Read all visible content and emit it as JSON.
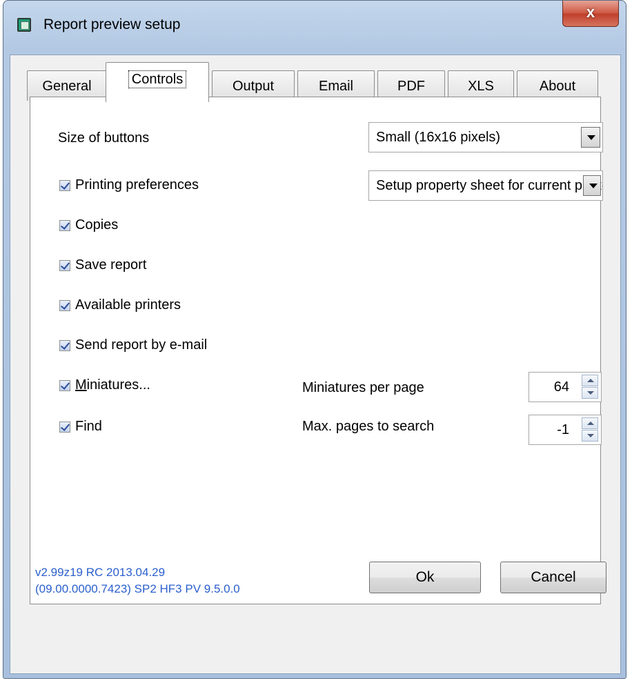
{
  "window": {
    "title": "Report preview setup",
    "close_glyph": "x"
  },
  "tabs": [
    {
      "label": "General",
      "active": false
    },
    {
      "label": "Controls",
      "active": true
    },
    {
      "label": "Output",
      "active": false
    },
    {
      "label": "Email",
      "active": false
    },
    {
      "label": "PDF",
      "active": false
    },
    {
      "label": "XLS",
      "active": false
    },
    {
      "label": "About",
      "active": false
    }
  ],
  "controls": {
    "size_of_buttons_label": "Size of buttons",
    "size_of_buttons_value": "Small (16x16 pixels)",
    "printing_preferences": {
      "label": "Printing preferences",
      "checked": true
    },
    "printing_preferences_value": "Setup property sheet for current printer",
    "copies": {
      "label": "Copies",
      "checked": true
    },
    "save_report": {
      "label": "Save report",
      "checked": true
    },
    "available_printers": {
      "label": "Available printers",
      "checked": true
    },
    "send_by_email": {
      "label": "Send report by e-mail",
      "checked": true
    },
    "miniatures": {
      "label_first": "M",
      "label_rest": "iniatures...",
      "checked": true
    },
    "find": {
      "label": "Find",
      "checked": true
    },
    "miniatures_per_page_label": "Miniatures per page",
    "miniatures_per_page_value": "64",
    "max_pages_label": "Max. pages to search",
    "max_pages_value": "-1"
  },
  "footer": {
    "version_line1": "v2.99z19 RC 2013.04.29",
    "version_line2": "(09.00.0000.7423) SP2 HF3   PV 9.5.0.0",
    "ok_label": "Ok",
    "cancel_label": "Cancel"
  },
  "colors": {
    "version_text": "#2a5fcc",
    "checkmark": "#2c4c98",
    "close_button": "#c7462f"
  }
}
